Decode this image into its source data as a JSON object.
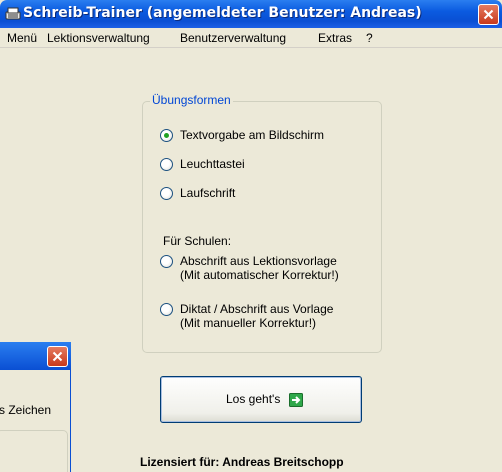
{
  "window": {
    "title": "Schreib-Trainer (angemeldeter Benutzer: Andreas)"
  },
  "menubar": {
    "items": [
      "Menü",
      "Lektionsverwaltung",
      "Benutzerverwaltung",
      "Extras",
      "?"
    ]
  },
  "exercise_group": {
    "legend": "Übungsformen",
    "options": [
      {
        "label": "Textvorgabe am Bildschirm",
        "selected": true
      },
      {
        "label": "Leuchttastei",
        "selected": false
      },
      {
        "label": "Laufschrift",
        "selected": false
      }
    ],
    "schools_label": "Für Schulen:",
    "school_options": [
      {
        "line1": "Abschrift aus Lektionsvorlage",
        "line2": "(Mit automatischer Korrektur!)",
        "selected": false
      },
      {
        "line1": "Diktat / Abschrift aus Vorlage",
        "line2": "(Mit manueller Korrektur!)",
        "selected": false
      }
    ]
  },
  "start_button": {
    "label": "Los geht's",
    "icon": "green-arrow-right-icon"
  },
  "license_text": "Lizensiert für: Andreas Breitschopp",
  "second_window": {
    "partial_text": "s Zeichen"
  },
  "colors": {
    "titlebar": "#0a4fd3",
    "group_legend": "#0046d5",
    "radio_selected": "#21a121",
    "close_button": "#c8391b"
  }
}
